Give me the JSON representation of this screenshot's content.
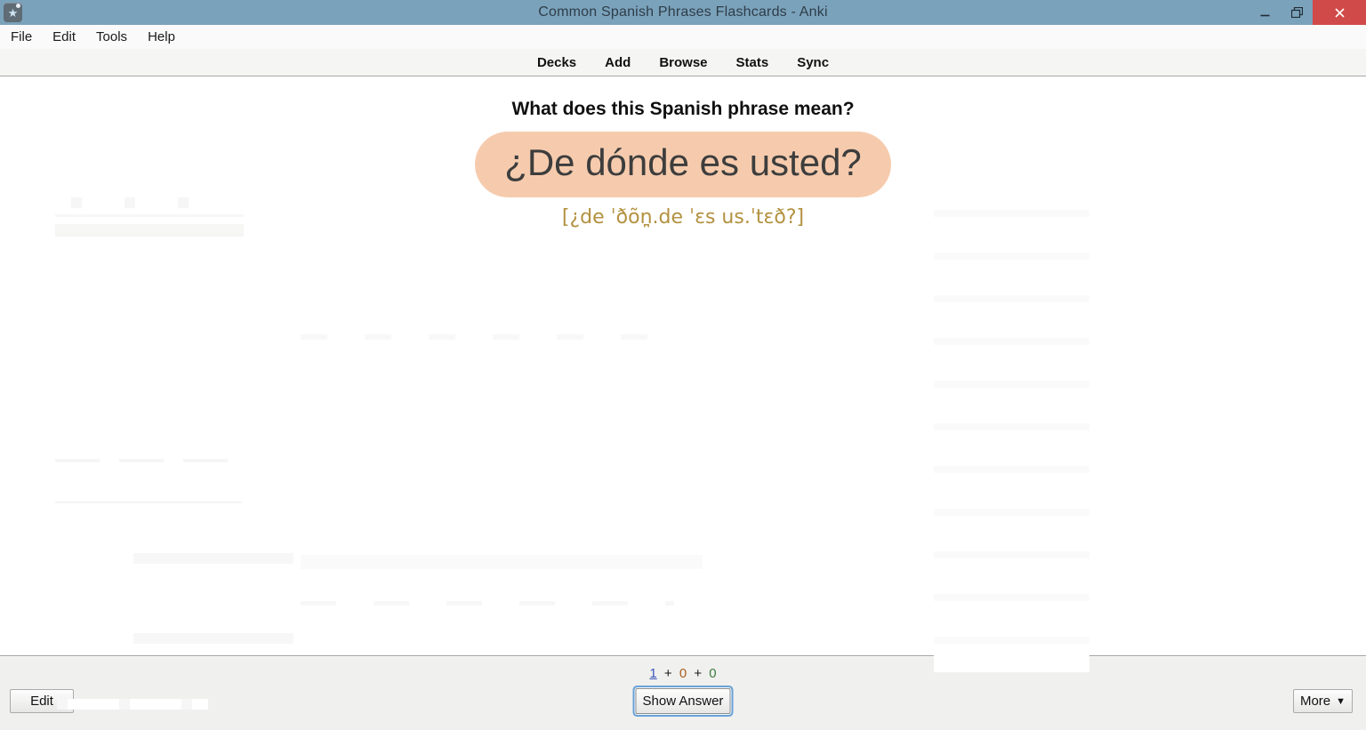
{
  "window": {
    "title": "Common Spanish Phrases Flashcards - Anki",
    "titlebar_color": "#7ba2bb",
    "close_color": "#d04a4a"
  },
  "menu": {
    "items": [
      {
        "label": "File"
      },
      {
        "label": "Edit"
      },
      {
        "label": "Tools"
      },
      {
        "label": "Help"
      }
    ]
  },
  "nav": {
    "items": [
      {
        "label": "Decks"
      },
      {
        "label": "Add"
      },
      {
        "label": "Browse"
      },
      {
        "label": "Stats"
      },
      {
        "label": "Sync"
      }
    ]
  },
  "card": {
    "question": "What does this Spanish phrase mean?",
    "phrase": "¿De dónde es usted?",
    "ipa": "[¿de ˈðõn̪.de ˈɛs us.ˈtɛð?]",
    "highlight_color": "#f6cbad",
    "ipa_color": "#b2913f"
  },
  "bottom": {
    "counts": {
      "new": "1",
      "learning": "0",
      "review": "0",
      "separator": "+",
      "new_color": "#3d55b8",
      "learning_color": "#a9611f",
      "review_color": "#3e7d3e"
    },
    "edit_label": "Edit",
    "show_answer_label": "Show Answer",
    "more_label": "More",
    "more_arrow": "▼"
  },
  "icons": {
    "app_star": "★"
  }
}
